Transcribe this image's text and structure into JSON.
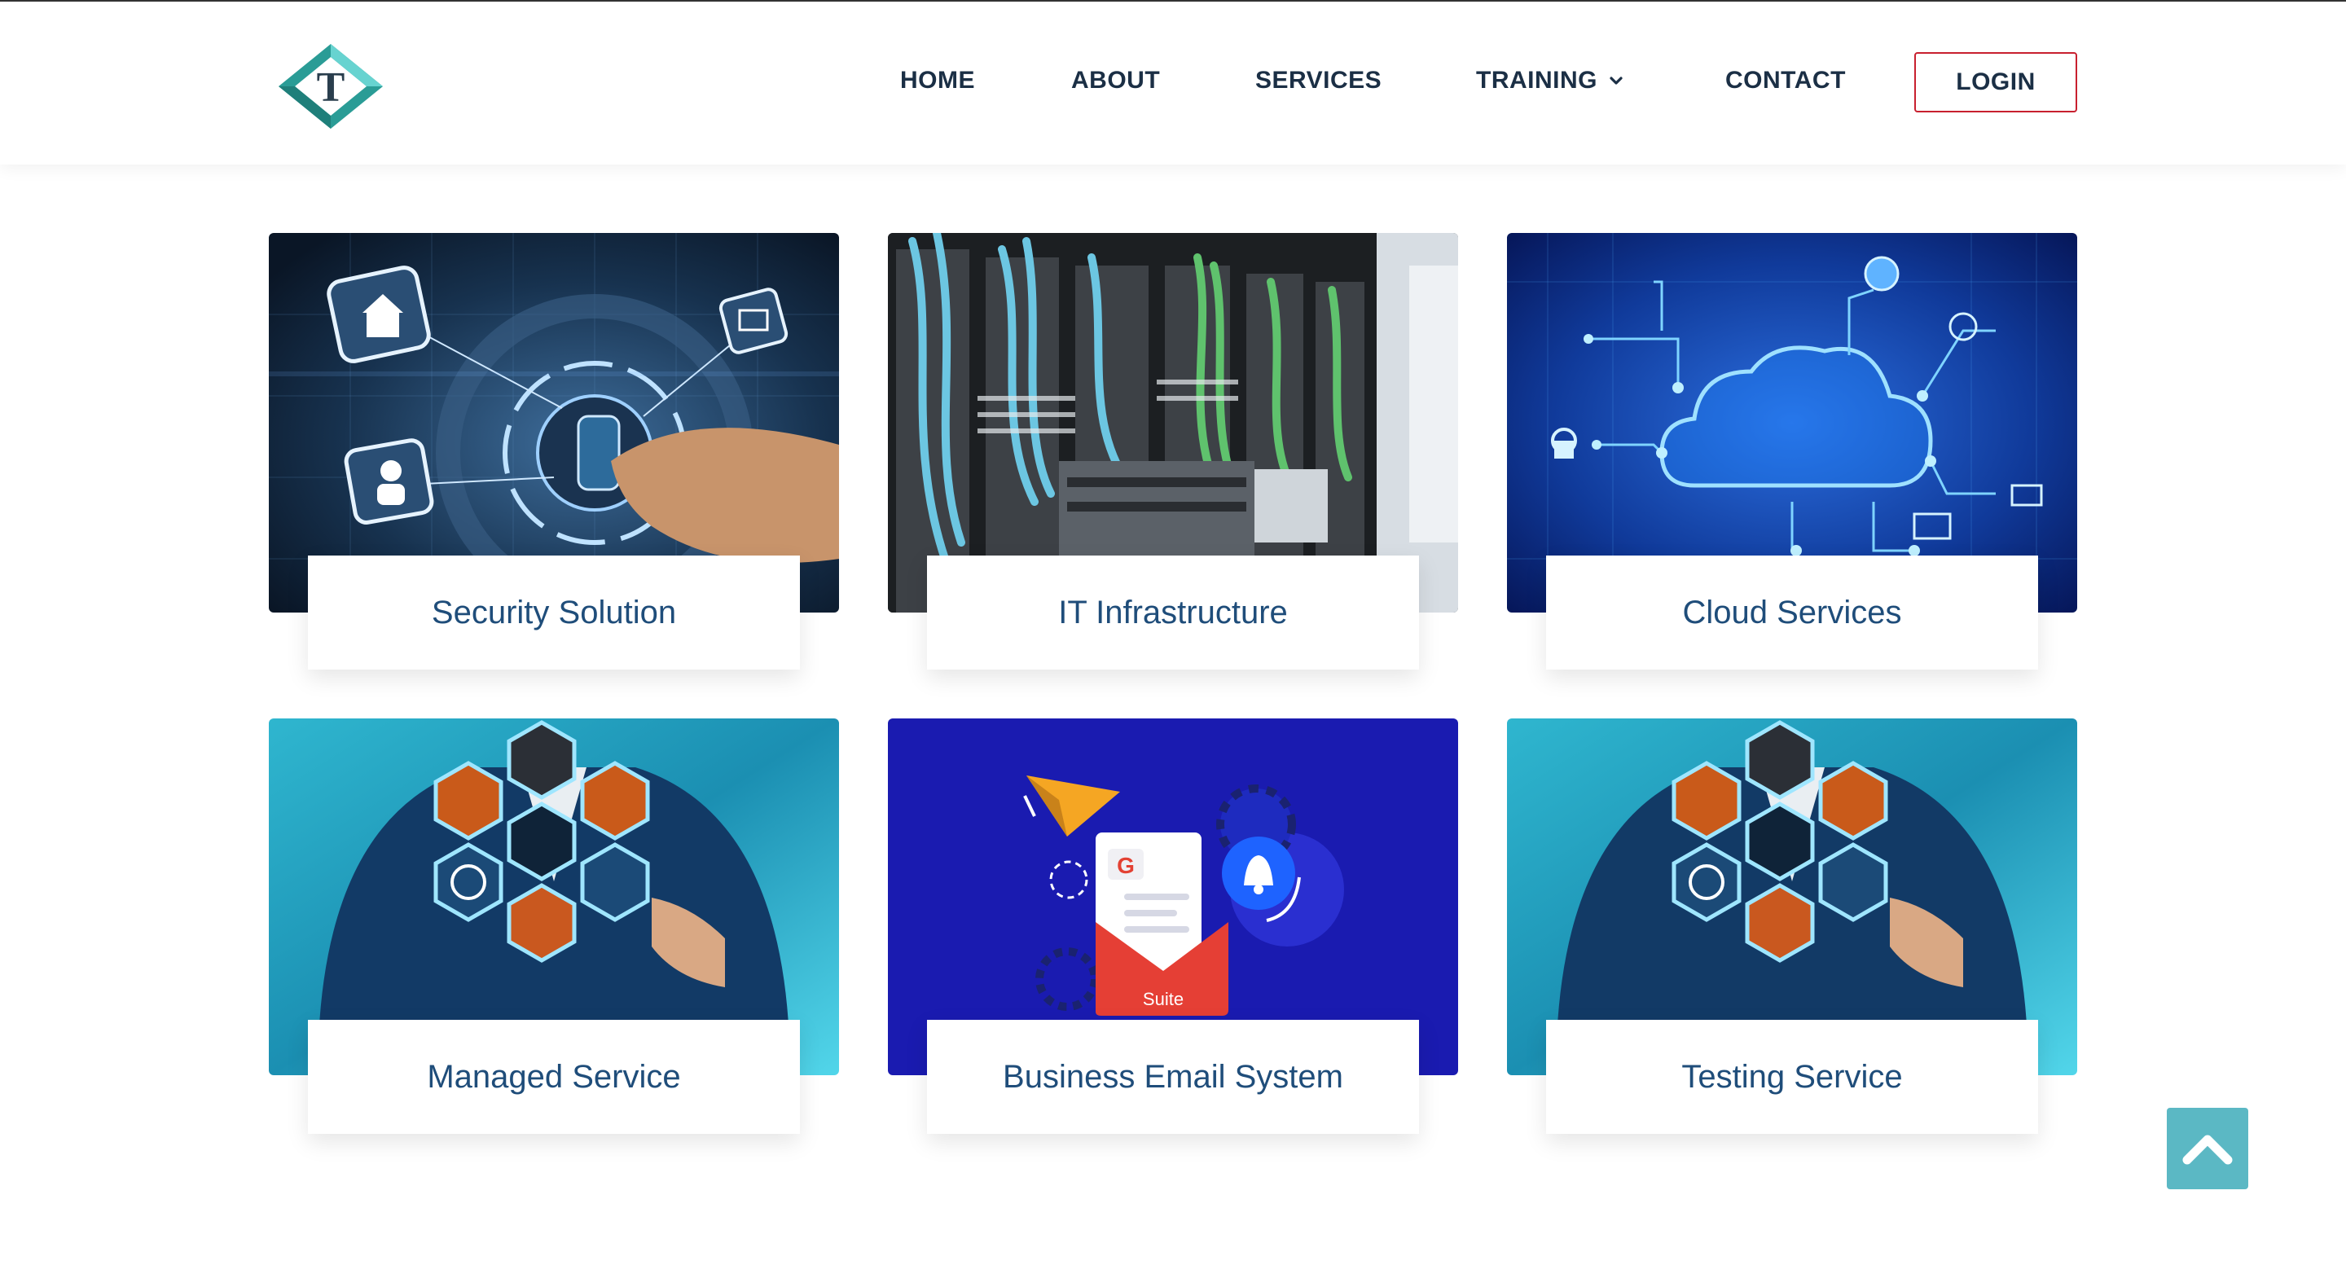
{
  "header": {
    "logo_letter": "T",
    "nav": [
      {
        "label": "HOME"
      },
      {
        "label": "ABOUT"
      },
      {
        "label": "SERVICES"
      },
      {
        "label": "TRAINING"
      },
      {
        "label": "CONTACT"
      }
    ],
    "login_label": "LOGIN"
  },
  "services": [
    {
      "title": "Security Solution"
    },
    {
      "title": "IT Infrastructure"
    },
    {
      "title": "Cloud Services"
    },
    {
      "title": "Managed Service"
    },
    {
      "title": "Business Email System"
    },
    {
      "title": "Testing Service"
    }
  ],
  "email_image": {
    "suite_label": "Suite",
    "g_letter": "G"
  },
  "colors": {
    "nav_text": "#1b2f45",
    "login_border": "#c8202f",
    "card_title": "#1f4d7a",
    "scroll_top_bg": "#5bb8c4",
    "logo_teal": "#2a9c96",
    "logo_light": "#67d3d0"
  },
  "icons": {
    "logo": "diamond-logo-icon",
    "training_dropdown": "chevron-down-icon",
    "scroll_top": "chevron-up-icon"
  }
}
